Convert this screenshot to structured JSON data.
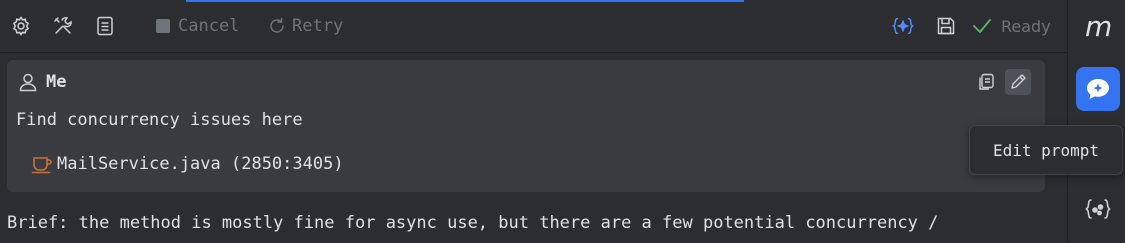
{
  "toolbar": {
    "settings_icon": "gear-icon",
    "tools_icon": "wrench-screwdriver-icon",
    "notes_icon": "document-icon",
    "cancel_label": "Cancel",
    "retry_label": "Retry",
    "ready_label": "Ready"
  },
  "message": {
    "author": "Me",
    "text": "Find concurrency issues here",
    "file_reference": "MailService.java (2850:3405)"
  },
  "response_text": "Brief: the method is mostly fine for async use, but there are a few potential concurrency /",
  "tooltip": "Edit prompt",
  "sidebar": {
    "logo": "m"
  },
  "colors": {
    "accent": "#3574f0",
    "background": "#2b2d30",
    "card": "#393b40",
    "success": "#5fb865",
    "file_icon": "#c7703f"
  }
}
